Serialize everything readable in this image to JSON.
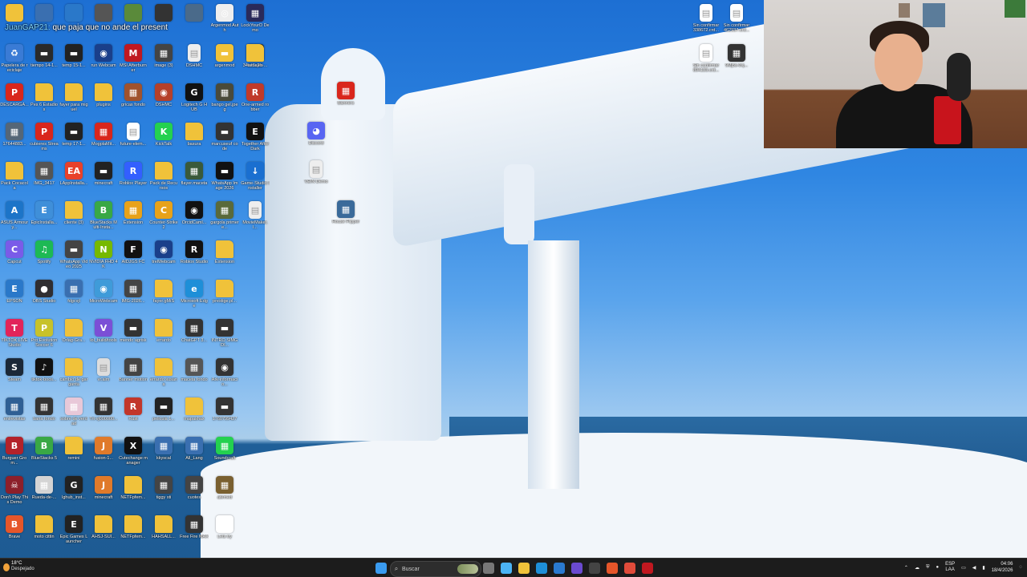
{
  "chat": {
    "user": "JuanGAP21:",
    "message": " que paja que no ande el present"
  },
  "icons": [
    {
      "label": "Papelera de reciclaje",
      "color": "#3a7bd5",
      "glyph": "♻",
      "icon": "recycle-bin-icon"
    },
    {
      "label": "DESCARGA...",
      "color": "#d9261c",
      "glyph": "P",
      "icon": "pdf-icon"
    },
    {
      "label": "17644883...",
      "color": "#556677",
      "glyph": "▦",
      "icon": "image-icon"
    },
    {
      "label": "Pack Cocacola",
      "color": "#f0c23a",
      "glyph": "",
      "icon": "folder-icon"
    },
    {
      "label": "ASUS Armoury...",
      "color": "#1c74c8",
      "glyph": "A",
      "icon": "app-icon"
    },
    {
      "label": "Capcut",
      "color": "#7a5be8",
      "glyph": "C",
      "icon": "capcut-icon"
    },
    {
      "label": "EPSON",
      "color": "#2a78c9",
      "glyph": "E",
      "icon": "app-icon"
    },
    {
      "label": "TIKTOK LIVE Studio",
      "color": "#e2245a",
      "glyph": "T",
      "icon": "tiktok-icon"
    },
    {
      "label": "Steam",
      "color": "#1b2838",
      "glyph": "S",
      "icon": "steam-icon"
    },
    {
      "label": "entrevistas",
      "color": "#2f5f94",
      "glyph": "▦",
      "icon": "video-icon"
    },
    {
      "label": "Burguer Grom...",
      "color": "#b3222a",
      "glyph": "B",
      "icon": "game-icon"
    },
    {
      "label": "Don't Play This Demo",
      "color": "#8c1f2a",
      "glyph": "☠",
      "icon": "game-icon"
    },
    {
      "label": "Brave",
      "color": "#e6562a",
      "glyph": "B",
      "icon": "brave-icon"
    },
    {
      "label": "tiempo 14-1...",
      "color": "#2a2a2a",
      "glyph": "▬",
      "icon": "video-icon"
    },
    {
      "label": "Pes 6 Estadios",
      "color": "#f0c23a",
      "glyph": "",
      "icon": "folder-icon"
    },
    {
      "label": "cubieres Streams",
      "color": "#d9261c",
      "glyph": "P",
      "icon": "pdf-icon"
    },
    {
      "label": "IMG_3417",
      "color": "#555",
      "glyph": "▦",
      "icon": "image-icon"
    },
    {
      "label": "EpicInstalla...",
      "color": "#3f8fd9",
      "glyph": "E",
      "icon": "app-icon"
    },
    {
      "label": "Spotify",
      "color": "#1db954",
      "glyph": "♫",
      "icon": "spotify-icon"
    },
    {
      "label": "OBS Studio",
      "color": "#302e31",
      "glyph": "●",
      "icon": "obs-icon"
    },
    {
      "label": "Pro Evolution Soccer 6",
      "color": "#c7c22a",
      "glyph": "P",
      "icon": "game-icon"
    },
    {
      "label": "tiktok-boos...",
      "color": "#111",
      "glyph": "♪",
      "icon": "tiktok-icon"
    },
    {
      "label": "bana fondo",
      "color": "#333",
      "glyph": "▦",
      "icon": "image-icon"
    },
    {
      "label": "BlueStacks 5",
      "color": "#39a845",
      "glyph": "B",
      "icon": "bluestacks-icon"
    },
    {
      "label": "Rueda-de-...",
      "color": "#d4d4d4",
      "glyph": "▦",
      "icon": "image-icon"
    },
    {
      "label": "moto cittin",
      "color": "#f0c23a",
      "glyph": "",
      "icon": "folder-icon"
    },
    {
      "label": "temp 15-1...",
      "color": "#222",
      "glyph": "▬",
      "icon": "video-icon"
    },
    {
      "label": "fayer para miguel",
      "color": "#f0c23a",
      "glyph": "",
      "icon": "folder-icon"
    },
    {
      "label": "temp 17-1...",
      "color": "#222",
      "glyph": "▬",
      "icon": "video-icon"
    },
    {
      "label": "LAppInstalla...",
      "color": "#e8412a",
      "glyph": "EA",
      "icon": "ea-icon"
    },
    {
      "label": "cliente (3)",
      "color": "#f0c23a",
      "glyph": "",
      "icon": "folder-icon"
    },
    {
      "label": "WhatsApp Video 2025",
      "color": "#444",
      "glyph": "▬",
      "icon": "video-icon"
    },
    {
      "label": "fdgcvjl",
      "color": "#3a6fb0",
      "glyph": "▦",
      "icon": "image-icon"
    },
    {
      "label": "Orlag-Gra...",
      "color": "#f0c23a",
      "glyph": "",
      "icon": "folder-icon"
    },
    {
      "label": "cambio de garganta",
      "color": "#f0c23a",
      "glyph": "",
      "icon": "folder-icon"
    },
    {
      "label": "sobre de verdad",
      "color": "#e8c8d8",
      "glyph": "▦",
      "icon": "image-icon"
    },
    {
      "label": "remini",
      "color": "#f0c23a",
      "glyph": "",
      "icon": "folder-icon"
    },
    {
      "label": "lghub_inst...",
      "color": "#222",
      "glyph": "G",
      "icon": "logitech-icon"
    },
    {
      "label": "Epic Games Launcher",
      "color": "#222",
      "glyph": "E",
      "icon": "epic-icon"
    },
    {
      "label": "run Webcam",
      "color": "#1a3f8a",
      "glyph": "◉",
      "icon": "webcam-icon"
    },
    {
      "label": "plugins",
      "color": "#f0c23a",
      "glyph": "",
      "icon": "folder-icon"
    },
    {
      "label": "MogplaMit...",
      "color": "#d9261c",
      "glyph": "▦",
      "icon": "archive-icon"
    },
    {
      "label": "minecraft",
      "color": "#222",
      "glyph": "▬",
      "icon": "video-icon"
    },
    {
      "label": "BlueStacks Multi-Insta...",
      "color": "#39a845",
      "glyph": "B",
      "icon": "bluestacks-icon"
    },
    {
      "label": "NVIDIA FHD 4K",
      "color": "#76b900",
      "glyph": "N",
      "icon": "nvidia-icon"
    },
    {
      "label": "MicroWebcam",
      "color": "#3f9bd9",
      "glyph": "◉",
      "icon": "app-icon"
    },
    {
      "label": "lol_build/tools",
      "color": "#7b4fd6",
      "glyph": "V",
      "icon": "vs-icon"
    },
    {
      "label": "vr.aim",
      "color": "#ddd",
      "glyph": "▤",
      "icon": "file-icon"
    },
    {
      "label": "Trt-vj000000...",
      "color": "#333",
      "glyph": "▦",
      "icon": "image-icon"
    },
    {
      "label": "fusion-1...",
      "color": "#e07a2a",
      "glyph": "J",
      "icon": "java-icon"
    },
    {
      "label": "minecraft",
      "color": "#e07a2a",
      "glyph": "J",
      "icon": "java-icon"
    },
    {
      "label": "AHSJ-SUI...",
      "color": "#f0c23a",
      "glyph": "",
      "icon": "folder-icon"
    },
    {
      "label": "MSI Afterburner",
      "color": "#c01820",
      "glyph": "M",
      "icon": "msi-icon"
    },
    {
      "label": "gricas fondo",
      "color": "#a0522d",
      "glyph": "▦",
      "icon": "image-icon"
    },
    {
      "label": "future-elem...",
      "color": "#ffffff",
      "glyph": "▤",
      "icon": "file-icon"
    },
    {
      "label": "Roblox Player",
      "color": "#335fff",
      "glyph": "R",
      "icon": "roblox-icon"
    },
    {
      "label": "Extension",
      "color": "#e8a21a",
      "glyph": "▦",
      "icon": "archive-icon"
    },
    {
      "label": "AIDJGS FC",
      "color": "#111",
      "glyph": "F",
      "icon": "app-icon"
    },
    {
      "label": "IMG-2026...",
      "color": "#444",
      "glyph": "▦",
      "icon": "image-icon"
    },
    {
      "label": "mendo agrisk",
      "color": "#333",
      "glyph": "▬",
      "icon": "video-icon"
    },
    {
      "label": "Banner motion",
      "color": "#444",
      "glyph": "▦",
      "icon": "image-icon"
    },
    {
      "label": "Rust",
      "color": "#c2362a",
      "glyph": "R",
      "icon": "rust-icon"
    },
    {
      "label": "Cutechange manager",
      "color": "#111",
      "glyph": "X",
      "icon": "app-icon"
    },
    {
      "label": "NETFpfem...",
      "color": "#f0c23a",
      "glyph": "",
      "icon": "folder-icon"
    },
    {
      "label": "NETFpfem...",
      "color": "#f0c23a",
      "glyph": "",
      "icon": "folder-icon"
    },
    {
      "label": "image (3)",
      "color": "#444",
      "glyph": "▦",
      "icon": "image-icon"
    },
    {
      "label": "DSHMC",
      "color": "#b5402a",
      "glyph": "◉",
      "icon": "app-icon"
    },
    {
      "label": "KickTalk",
      "color": "#24d14f",
      "glyph": "K",
      "icon": "kick-icon"
    },
    {
      "label": "Pack de Recursos",
      "color": "#f0c23a",
      "glyph": "",
      "icon": "folder-icon"
    },
    {
      "label": "Counter-Strike 2",
      "color": "#e8a21a",
      "glyph": "C",
      "icon": "cs-icon"
    },
    {
      "label": "trelWebcam",
      "color": "#1a3f8a",
      "glyph": "◉",
      "icon": "webcam-icon"
    },
    {
      "label": "fayer.gMiS",
      "color": "#f0c23a",
      "glyph": "",
      "icon": "folder-icon"
    },
    {
      "label": "errardo",
      "color": "#f0c23a",
      "glyph": "",
      "icon": "folder-icon"
    },
    {
      "label": "errardo susana",
      "color": "#f0c23a",
      "glyph": "",
      "icon": "folder-icon"
    },
    {
      "label": "pelicula 1...",
      "color": "#222",
      "glyph": "▬",
      "icon": "video-icon"
    },
    {
      "label": "kkyscal",
      "color": "#3a6fb0",
      "glyph": "▦",
      "icon": "image-icon"
    },
    {
      "label": "tiggy sti",
      "color": "#444",
      "glyph": "▦",
      "icon": "image-icon"
    },
    {
      "label": "HAHSALL...",
      "color": "#f0c23a",
      "glyph": "",
      "icon": "folder-icon"
    },
    {
      "label": "DSHMC",
      "color": "#eee",
      "glyph": "▤",
      "icon": "file-icon"
    },
    {
      "label": "Logitech G HUB",
      "color": "#111",
      "glyph": "G",
      "icon": "logitech-icon"
    },
    {
      "label": "basura",
      "color": "#f0c23a",
      "glyph": "",
      "icon": "folder-icon"
    },
    {
      "label": "flayer.maceta",
      "color": "#3a5a3a",
      "glyph": "▦",
      "icon": "image-icon"
    },
    {
      "label": "OrcidCaml...",
      "color": "#111",
      "glyph": "◉",
      "icon": "app-icon"
    },
    {
      "label": "Roblox Studio",
      "color": "#111",
      "glyph": "R",
      "icon": "roblox-icon"
    },
    {
      "label": "Microsoft Edge",
      "color": "#1e8fd8",
      "glyph": "e",
      "icon": "edge-icon"
    },
    {
      "label": "ChatGPT 3...",
      "color": "#333",
      "glyph": "▦",
      "icon": "image-icon"
    },
    {
      "label": "maceta fondo",
      "color": "#555",
      "glyph": "▦",
      "icon": "image-icon"
    },
    {
      "label": "mapashax",
      "color": "#f0c23a",
      "glyph": "",
      "icon": "folder-icon"
    },
    {
      "label": "All_Lang",
      "color": "#3a6fb0",
      "glyph": "▦",
      "icon": "image-icon"
    },
    {
      "label": "cuotes",
      "color": "#444",
      "glyph": "▦",
      "icon": "image-icon"
    },
    {
      "label": "Free Fire MAX",
      "color": "#333",
      "glyph": "▦",
      "icon": "game-icon"
    },
    {
      "label": "argenmod",
      "color": "#f0c23a",
      "glyph": "▬",
      "icon": "archive-icon"
    },
    {
      "label": "bango gel.jpeg",
      "color": "#4a4a3a",
      "glyph": "▦",
      "icon": "image-icon"
    },
    {
      "label": "marcuseuf code",
      "color": "#333",
      "glyph": "▬",
      "icon": "video-icon"
    },
    {
      "label": "WhatsApp Image 2026",
      "color": "#111",
      "glyph": "▬",
      "icon": "video-icon"
    },
    {
      "label": "gargola primer e...",
      "color": "#5a6a3a",
      "glyph": "▦",
      "icon": "image-icon"
    },
    {
      "label": "Extension",
      "color": "#f0c23a",
      "glyph": "",
      "icon": "folder-icon"
    },
    {
      "label": "prestige.pl...",
      "color": "#f0c23a",
      "glyph": "",
      "icon": "folder-icon"
    },
    {
      "label": "INTRO SIMGOI...",
      "color": "#333",
      "glyph": "▬",
      "icon": "video-icon"
    },
    {
      "label": "Ark-informacio...",
      "color": "#333",
      "glyph": "◉",
      "icon": "app-icon"
    },
    {
      "label": "1760799427",
      "color": "#333",
      "glyph": "▬",
      "icon": "video-icon"
    },
    {
      "label": "Soundcraft",
      "color": "#24d14f",
      "glyph": "▦",
      "icon": "app-icon"
    },
    {
      "label": "atemed",
      "color": "#7a6030",
      "glyph": "▦",
      "icon": "image-icon"
    },
    {
      "label": "Lets try",
      "color": "#ffffff",
      "glyph": "◆",
      "icon": "app-icon"
    },
    {
      "label": "34ee5c2b-...",
      "color": "#222",
      "glyph": "▬",
      "icon": "phone-icon"
    },
    {
      "label": "One-armed robber",
      "color": "#c03a2a",
      "glyph": "R",
      "icon": "game-icon"
    },
    {
      "label": "Together After Dark",
      "color": "#111",
      "glyph": "E",
      "icon": "epic-icon"
    },
    {
      "label": "Game-Studio Installer",
      "color": "#1a6fd0",
      "glyph": "↓",
      "icon": "installer-icon"
    },
    {
      "label": "MovieMaker.l...",
      "color": "#eee",
      "glyph": "▤",
      "icon": "file-icon"
    },
    {
      "label": "Argenmod Auth",
      "color": "#eee",
      "glyph": "◎",
      "icon": "app-icon"
    },
    {
      "label": "LockYourD Demo",
      "color": "#2a2a5a",
      "glyph": "▦",
      "icon": "game-icon"
    },
    {
      "label": "tatuajes",
      "color": "#f0c23a",
      "glyph": "",
      "icon": "folder-icon"
    },
    {
      "label": "Banners",
      "color": "#d9261c",
      "glyph": "▦",
      "icon": "archive-icon"
    },
    {
      "label": "Discord",
      "color": "#5865f2",
      "glyph": "◕",
      "icon": "discord-icon"
    },
    {
      "label": "VEIN Demo",
      "color": "#eee",
      "glyph": "▤",
      "icon": "file-icon"
    },
    {
      "label": "House Flipper",
      "color": "#3a6a9a",
      "glyph": "▦",
      "icon": "game-icon"
    },
    {
      "label": "Sin confirmar 338672.crd...",
      "color": "#ffffff",
      "glyph": "▤",
      "icon": "file-icon"
    },
    {
      "label": "Sin confirmar 462937.crd...",
      "color": "#ffffff",
      "glyph": "▤",
      "icon": "file-icon"
    },
    {
      "label": "Sin confirmar 894133.crd...",
      "color": "#ffffff",
      "glyph": "▤",
      "icon": "file-icon"
    },
    {
      "label": "9Mj5s-0vj...",
      "color": "#333",
      "glyph": "▦",
      "icon": "image-icon"
    }
  ],
  "taskbar": {
    "temperature": "18°C",
    "weather": "Despejado",
    "search_placeholder": "Buscar",
    "language_top": "ESP",
    "language_bottom": "LAA",
    "time": "04:06",
    "date": "18/4/2026",
    "pinned": [
      {
        "icon": "windows-start-icon",
        "color": "#3a9bf0"
      },
      {
        "icon": "task-view-icon",
        "color": "#777"
      },
      {
        "icon": "copilot-icon",
        "color": "#4bb3f5"
      },
      {
        "icon": "file-explorer-icon",
        "color": "#f0c23a"
      },
      {
        "icon": "edge-icon",
        "color": "#1e8fd8"
      },
      {
        "icon": "store-icon",
        "color": "#2a7ad0"
      },
      {
        "icon": "fe-app-icon",
        "color": "#6a4ad0"
      },
      {
        "icon": "msi-center-icon",
        "color": "#444"
      },
      {
        "icon": "brave-icon",
        "color": "#e6562a"
      },
      {
        "icon": "chrome-icon",
        "color": "#e04b3a"
      },
      {
        "icon": "recording-icon",
        "color": "#c01820"
      }
    ]
  }
}
